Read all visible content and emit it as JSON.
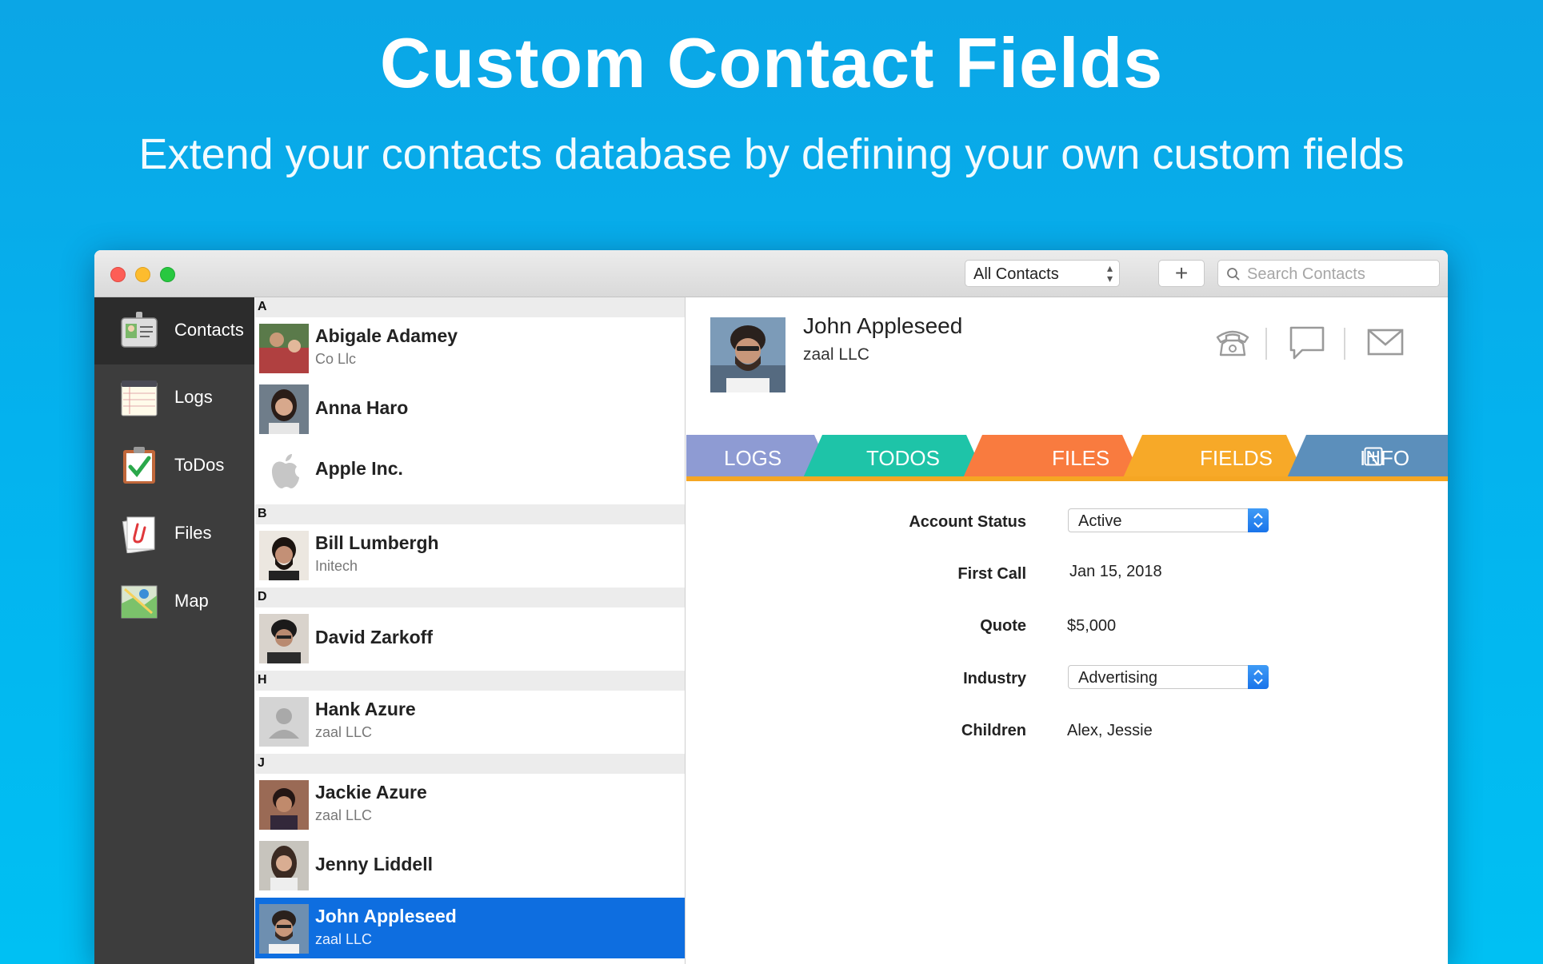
{
  "hero": {
    "title": "Custom Contact Fields",
    "subtitle": "Extend your contacts database by defining your own custom fields"
  },
  "toolbar": {
    "scope_select": "All Contacts",
    "add_label": "+",
    "search_placeholder": "Search Contacts"
  },
  "sidebar": {
    "items": [
      {
        "label": "Contacts",
        "icon": "contacts-card-icon",
        "active": true
      },
      {
        "label": "Logs",
        "icon": "logs-notepad-icon",
        "active": false
      },
      {
        "label": "ToDos",
        "icon": "todos-clipboard-icon",
        "active": false
      },
      {
        "label": "Files",
        "icon": "files-paperclip-icon",
        "active": false
      },
      {
        "label": "Map",
        "icon": "map-icon",
        "active": false
      }
    ]
  },
  "contact_list": {
    "sections": [
      {
        "letter": "A",
        "contacts": [
          {
            "name": "Abigale Adamey",
            "company": "Co Llc"
          },
          {
            "name": "Anna Haro",
            "company": ""
          },
          {
            "name": "Apple Inc.",
            "company": ""
          }
        ]
      },
      {
        "letter": "B",
        "contacts": [
          {
            "name": "Bill Lumbergh",
            "company": "Initech"
          }
        ]
      },
      {
        "letter": "D",
        "contacts": [
          {
            "name": "David Zarkoff",
            "company": ""
          }
        ]
      },
      {
        "letter": "H",
        "contacts": [
          {
            "name": "Hank Azure",
            "company": "zaal LLC"
          }
        ]
      },
      {
        "letter": "J",
        "contacts": [
          {
            "name": "Jackie Azure",
            "company": "zaal LLC"
          },
          {
            "name": "Jenny Liddell",
            "company": ""
          },
          {
            "name": "John Appleseed",
            "company": "zaal LLC",
            "selected": true
          }
        ]
      }
    ]
  },
  "detail": {
    "name": "John Appleseed",
    "company": "zaal LLC",
    "actions": [
      "phone-icon",
      "message-icon",
      "mail-icon"
    ],
    "tabs": [
      {
        "label": "LOGS",
        "color": "#8e9bd3"
      },
      {
        "label": "TODOS",
        "color": "#1ec4a8"
      },
      {
        "label": "FILES",
        "color": "#f97b3f"
      },
      {
        "label": "FIELDS",
        "color": "#f7a928",
        "active": true
      },
      {
        "label": "INFO",
        "color": "#5c8fbb"
      }
    ],
    "fields": [
      {
        "label": "Account Status",
        "value": "Active",
        "type": "popup"
      },
      {
        "label": "First Call",
        "value": "Jan 15, 2018",
        "type": "text"
      },
      {
        "label": "Quote",
        "value": "$5,000",
        "type": "text"
      },
      {
        "label": "Industry",
        "value": "Advertising",
        "type": "popup"
      },
      {
        "label": "Children",
        "value": "Alex, Jessie",
        "type": "text"
      }
    ]
  },
  "colors": {
    "background": "#06b0ec",
    "selection": "#0e6ee0",
    "sidebar": "#3d3d3d",
    "fields_accent": "#f5a623"
  }
}
